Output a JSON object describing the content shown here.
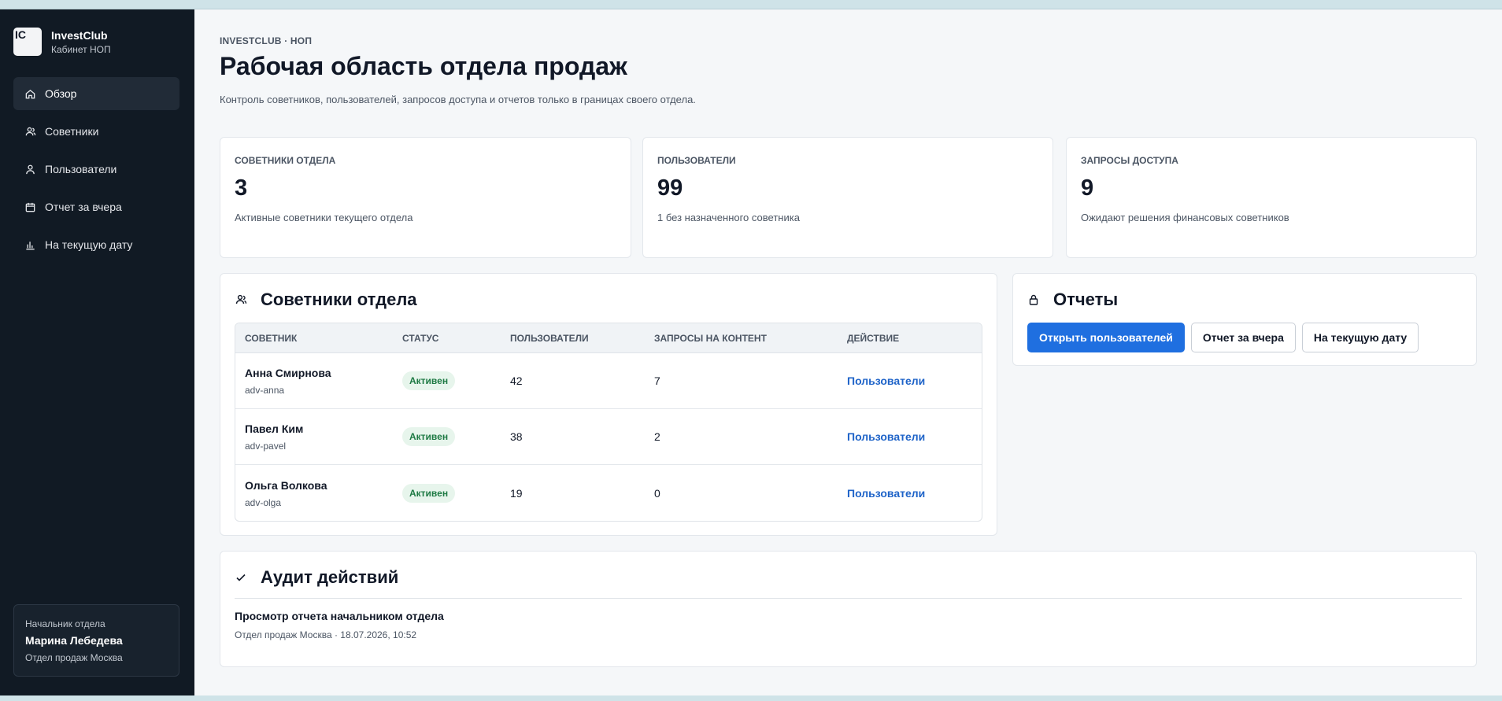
{
  "brand": {
    "logo_text": "IC",
    "name": "InvestClub",
    "subtitle": "Кабинет НОП"
  },
  "sidebar": {
    "items": [
      {
        "label": "Обзор",
        "icon": "home-icon",
        "active": true
      },
      {
        "label": "Советники",
        "icon": "users-icon"
      },
      {
        "label": "Пользователи",
        "icon": "user-icon"
      },
      {
        "label": "Отчет за вчера",
        "icon": "calendar-icon"
      },
      {
        "label": "На текущую дату",
        "icon": "bar-chart-icon"
      }
    ],
    "profile": {
      "role": "Начальник отдела",
      "name": "Марина Лебедева",
      "department": "Отдел продаж Москва"
    }
  },
  "header": {
    "eyebrow": "INVESTCLUB · НОП",
    "title": "Рабочая область отдела продаж",
    "subtitle": "Контроль советников, пользователей, запросов доступа и отчетов только в границах своего отдела."
  },
  "stats": [
    {
      "label": "Советники отдела",
      "value": "3",
      "note": "Активные советники текущего отдела"
    },
    {
      "label": "Пользователи",
      "value": "99",
      "note": "1 без назначенного советника"
    },
    {
      "label": "Запросы доступа",
      "value": "9",
      "note": "Ожидают решения финансовых советников"
    }
  ],
  "advisors": {
    "title": "Советники отдела",
    "icon": "users-icon",
    "columns": [
      "СОВЕТНИК",
      "СТАТУС",
      "ПОЛЬЗОВАТЕЛИ",
      "ЗАПРОСЫ НА КОНТЕНТ",
      "ДЕЙСТВИЕ"
    ],
    "rows": [
      {
        "name": "Анна Смирнова",
        "id": "adv-anna",
        "status": "Активен",
        "users": "42",
        "requests": "7",
        "action": "Пользователи"
      },
      {
        "name": "Павел Ким",
        "id": "adv-pavel",
        "status": "Активен",
        "users": "38",
        "requests": "2",
        "action": "Пользователи"
      },
      {
        "name": "Ольга Волкова",
        "id": "adv-olga",
        "status": "Активен",
        "users": "19",
        "requests": "0",
        "action": "Пользователи"
      }
    ]
  },
  "reports": {
    "title": "Отчеты",
    "icon": "lock-icon",
    "buttons": [
      "Открыть пользователей",
      "Отчет за вчера",
      "На текущую дату"
    ]
  },
  "audit": {
    "title": "Аудит действий",
    "icon": "check-icon",
    "entries": [
      {
        "title": "Просмотр отчета начальником отдела",
        "meta": "Отдел продаж Москва · 18.07.2026, 10:52"
      }
    ]
  },
  "colors": {
    "sidebar_bg": "#111a24",
    "accent": "#1f6fe0",
    "link": "#1e63c8",
    "badge_bg": "#e7f5ec",
    "badge_text": "#1e7a44"
  }
}
